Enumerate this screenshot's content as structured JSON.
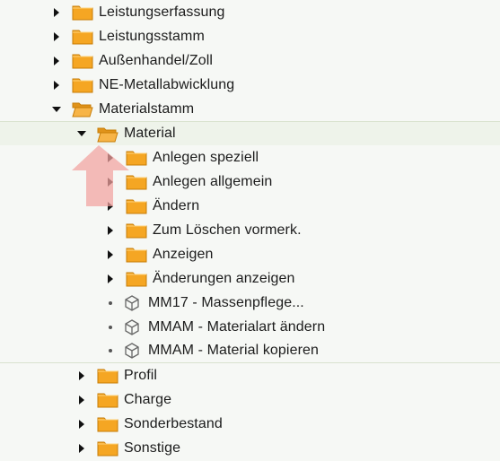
{
  "tree": {
    "items": [
      {
        "label": "Leistungserfassung",
        "type": "folder",
        "expanded": false,
        "level": 0
      },
      {
        "label": "Leistungsstamm",
        "type": "folder",
        "expanded": false,
        "level": 0
      },
      {
        "label": "Außenhandel/Zoll",
        "type": "folder",
        "expanded": false,
        "level": 0
      },
      {
        "label": "NE-Metallabwicklung",
        "type": "folder",
        "expanded": false,
        "level": 0
      },
      {
        "label": "Materialstamm",
        "type": "folder",
        "expanded": true,
        "level": 0
      },
      {
        "label": "Material",
        "type": "folder",
        "expanded": true,
        "level": 1,
        "selected": true
      },
      {
        "label": "Anlegen speziell",
        "type": "folder",
        "expanded": false,
        "level": 2
      },
      {
        "label": "Anlegen allgemein",
        "type": "folder",
        "expanded": false,
        "level": 2
      },
      {
        "label": "Ändern",
        "type": "folder",
        "expanded": false,
        "level": 2
      },
      {
        "label": "Zum Löschen vormerk.",
        "type": "folder",
        "expanded": false,
        "level": 2
      },
      {
        "label": "Anzeigen",
        "type": "folder",
        "expanded": false,
        "level": 2
      },
      {
        "label": "Änderungen anzeigen",
        "type": "folder",
        "expanded": false,
        "level": 2
      },
      {
        "label": "MM17 - Massenpflege...",
        "type": "transaction",
        "level": 2
      },
      {
        "label": "MMAM - Materialart ändern",
        "type": "transaction",
        "level": 2
      },
      {
        "label": "MMAM - Material kopieren",
        "type": "transaction",
        "level": 2
      },
      {
        "label": "Profil",
        "type": "folder",
        "expanded": false,
        "level": 1
      },
      {
        "label": "Charge",
        "type": "folder",
        "expanded": false,
        "level": 1
      },
      {
        "label": "Sonderbestand",
        "type": "folder",
        "expanded": false,
        "level": 1
      },
      {
        "label": "Sonstige",
        "type": "folder",
        "expanded": false,
        "level": 1
      }
    ]
  },
  "colors": {
    "folder_fill": "#f5a623",
    "folder_edge": "#c77c06",
    "highlight_arrow": "#f3a3a0",
    "selected_row": "#eef3ea"
  },
  "icons": {
    "collapsed": "triangle-right-icon",
    "expanded": "triangle-down-icon",
    "folder": "folder-icon",
    "folder_open": "folder-open-icon",
    "transaction": "transaction-cube-icon",
    "pointer": "up-arrow-pointer-icon"
  }
}
